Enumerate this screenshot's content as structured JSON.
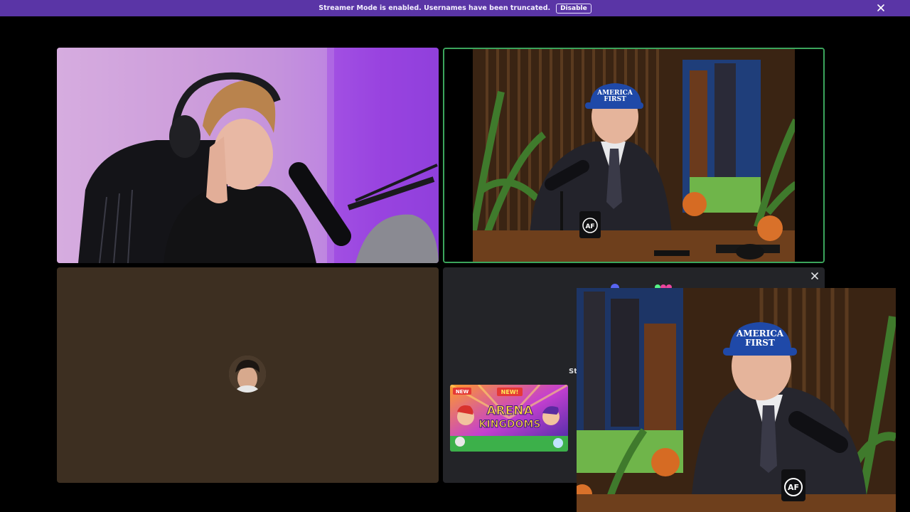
{
  "banner": {
    "message": "Streamer Mode is enabled. Usernames have been truncated.",
    "disable_label": "Disable",
    "background": "#5a35a6"
  },
  "tiles": [
    {
      "id": "tile-1",
      "type": "webcam"
    },
    {
      "id": "tile-2",
      "type": "webcam",
      "speaking": true,
      "speaking_color": "#3ba55c",
      "cap_text": [
        "AMERICA",
        "FIRST"
      ],
      "mug_text": "AF"
    },
    {
      "id": "tile-3",
      "type": "avatar"
    },
    {
      "id": "tile-4",
      "type": "activity",
      "partial_label": "St"
    }
  ],
  "ad": {
    "badge_new": "NEW",
    "title_new": "NEW!",
    "title_line1": "ARENA",
    "title_line2": "KINGDOMS"
  },
  "pip": {
    "cap_text": [
      "AMERICA",
      "FIRST"
    ],
    "mug_text": "AF"
  },
  "icons": {
    "banner_close": "close-icon",
    "tile_close": "close-icon"
  }
}
